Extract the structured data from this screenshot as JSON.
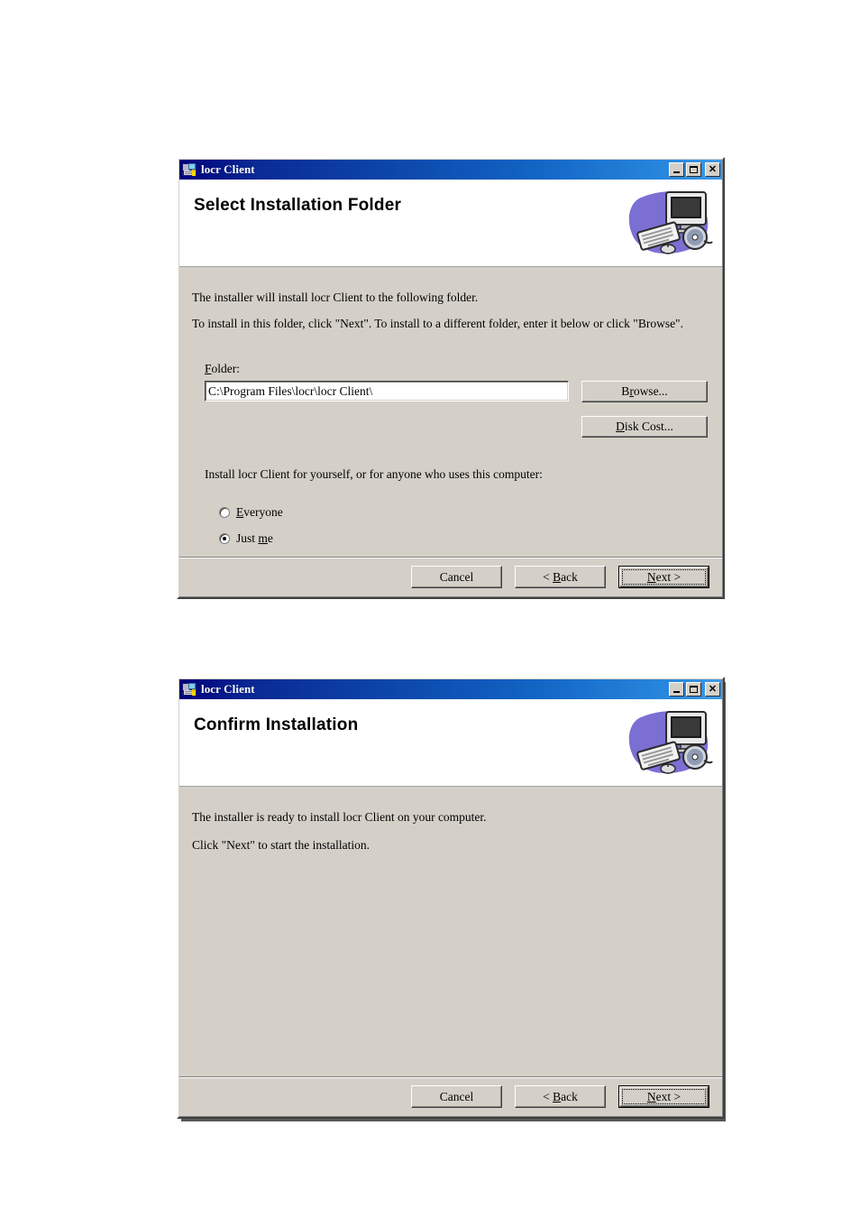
{
  "page": {
    "background": "#ffffff",
    "dialog_face_color": "#d4d0c8",
    "titlebar_color_start": "#00007a",
    "titlebar_color_end": "#3d9ae8"
  },
  "dialogs": [
    {
      "title": "locr Client",
      "window_icon": "windows-installer-icon",
      "controls": {
        "minimize": "minimize-icon",
        "maximize": "maximize-icon",
        "close": "close-icon"
      },
      "header": {
        "heading": "Select Installation Folder",
        "art": "computer-setup-illustration"
      },
      "body": {
        "line1": "The installer will install locr Client to the following folder.",
        "line2": "To install in this folder, click \"Next\". To install to a different folder, enter it below or click \"Browse\".",
        "folder_label_pre": "F",
        "folder_label_post": "older:",
        "folder_value": "C:\\Program Files\\locr\\locr Client\\",
        "browse_pre": "B",
        "browse_accel": "r",
        "browse_post": "owse...",
        "diskcost_accel": "D",
        "diskcost_post": "isk Cost...",
        "scope_prompt": "Install locr Client for yourself, or for anyone who uses this computer:",
        "radios": [
          {
            "accel": "E",
            "rest": "veryone",
            "selected": false
          },
          {
            "pre": "Just ",
            "accel": "m",
            "rest": "e",
            "selected": true
          }
        ]
      },
      "footer": {
        "cancel": "Cancel",
        "back_pre": "< ",
        "back_accel": "B",
        "back_post": "ack",
        "next_accel": "N",
        "next_post": "ext >",
        "default_button": "next"
      }
    },
    {
      "title": "locr Client",
      "window_icon": "windows-installer-icon",
      "controls": {
        "minimize": "minimize-icon",
        "maximize": "maximize-icon",
        "close": "close-icon"
      },
      "header": {
        "heading": "Confirm Installation",
        "art": "computer-setup-illustration"
      },
      "body": {
        "line1": "The installer is ready to install locr Client on your computer.",
        "line2": "Click \"Next\" to start the installation."
      },
      "footer": {
        "cancel": "Cancel",
        "back_pre": "< ",
        "back_accel": "B",
        "back_post": "ack",
        "next_accel": "N",
        "next_post": "ext >",
        "default_button": "next"
      }
    }
  ]
}
